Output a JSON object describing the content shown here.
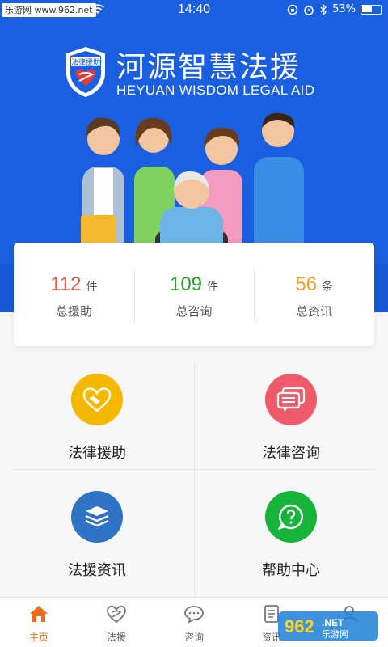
{
  "status_bar": {
    "watermark": "乐游网 www.962.net",
    "time": "14:40",
    "battery_percent": "53%",
    "icons": [
      "wifi-icon",
      "rotation-lock-icon",
      "alarm-icon",
      "bluetooth-icon",
      "battery-icon"
    ]
  },
  "header": {
    "badge_text": "法律援助",
    "title_cn": "河源智慧法援",
    "title_en": "HEYUAN WISDOM LEGAL AID"
  },
  "stats": [
    {
      "number": "112",
      "unit": "件",
      "label": "总援助",
      "color": "#e05a4a"
    },
    {
      "number": "109",
      "unit": "件",
      "label": "总咨询",
      "color": "#2aa02a"
    },
    {
      "number": "56",
      "unit": "条",
      "label": "总资讯",
      "color": "#f0a020"
    }
  ],
  "menu": [
    {
      "label": "法律援助",
      "icon": "handshake-heart-icon",
      "color": "#f5b800"
    },
    {
      "label": "法律咨询",
      "icon": "chat-bubbles-icon",
      "color": "#ef5b6a"
    },
    {
      "label": "法援资讯",
      "icon": "stacked-books-icon",
      "color": "#2f74c4"
    },
    {
      "label": "帮助中心",
      "icon": "question-bubble-icon",
      "color": "#16b43a"
    }
  ],
  "tabbar": [
    {
      "label": "主页",
      "icon": "home-icon",
      "active": true
    },
    {
      "label": "法援",
      "icon": "heart-emblem-icon",
      "active": false
    },
    {
      "label": "咨询",
      "icon": "chat-icon",
      "active": false
    },
    {
      "label": "资讯",
      "icon": "document-icon",
      "active": false
    },
    {
      "label": "",
      "icon": "user-icon",
      "active": false
    }
  ],
  "colors": {
    "brand_blue": "#1a5fe0",
    "active_tab": "#ef6c1c"
  },
  "site_logo": "962.NET 乐游网"
}
